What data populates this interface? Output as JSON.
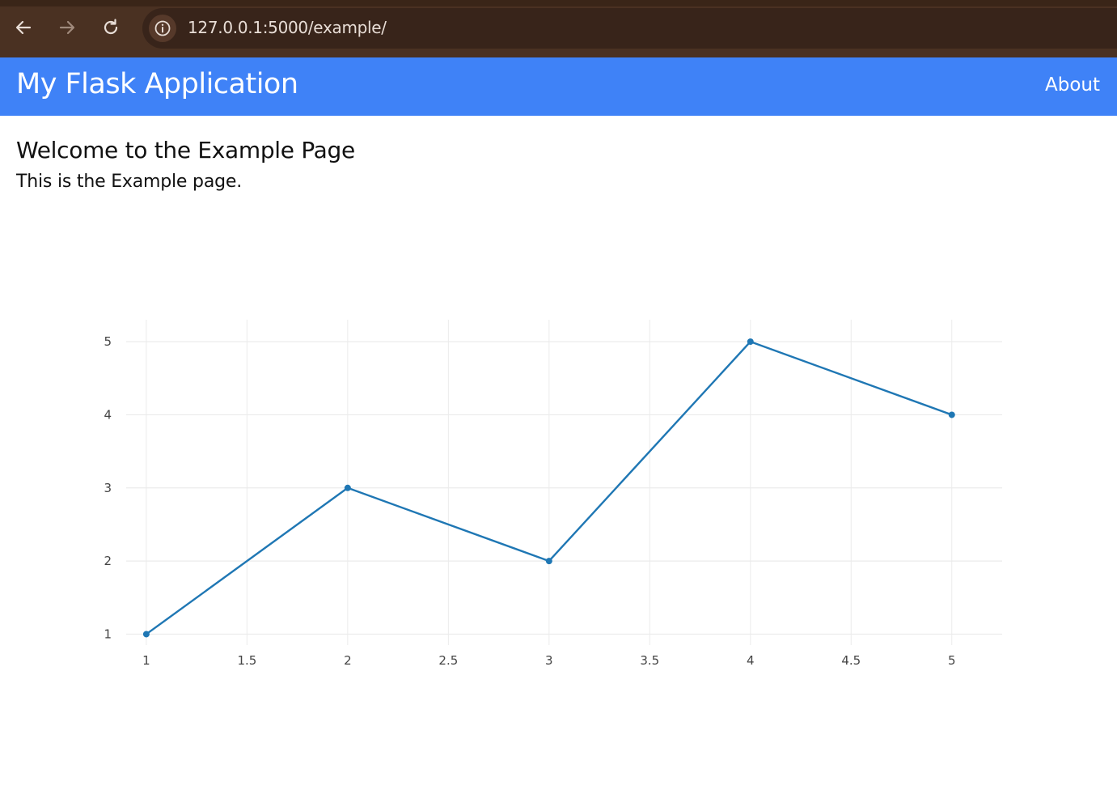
{
  "browser": {
    "url": "127.0.0.1:5000/example/"
  },
  "app": {
    "title": "My Flask Application",
    "nav_about": "About"
  },
  "page": {
    "heading": "Welcome to the Example Page",
    "text": "This is the Example page."
  },
  "colors": {
    "header": "#3f82f7",
    "line": "#1f77b4",
    "grid": "#ebebeb"
  },
  "chart_data": {
    "type": "line",
    "mode": "lines+markers",
    "x": [
      1,
      2,
      3,
      4,
      5
    ],
    "y": [
      1,
      3,
      2,
      5,
      4
    ],
    "xlim": [
      0.9,
      5.25
    ],
    "ylim": [
      0.85,
      5.3
    ],
    "x_ticks": [
      1,
      1.5,
      2,
      2.5,
      3,
      3.5,
      4,
      4.5,
      5
    ],
    "y_ticks": [
      1,
      2,
      3,
      4,
      5
    ],
    "grid": true,
    "title": "",
    "xlabel": "",
    "ylabel": ""
  }
}
